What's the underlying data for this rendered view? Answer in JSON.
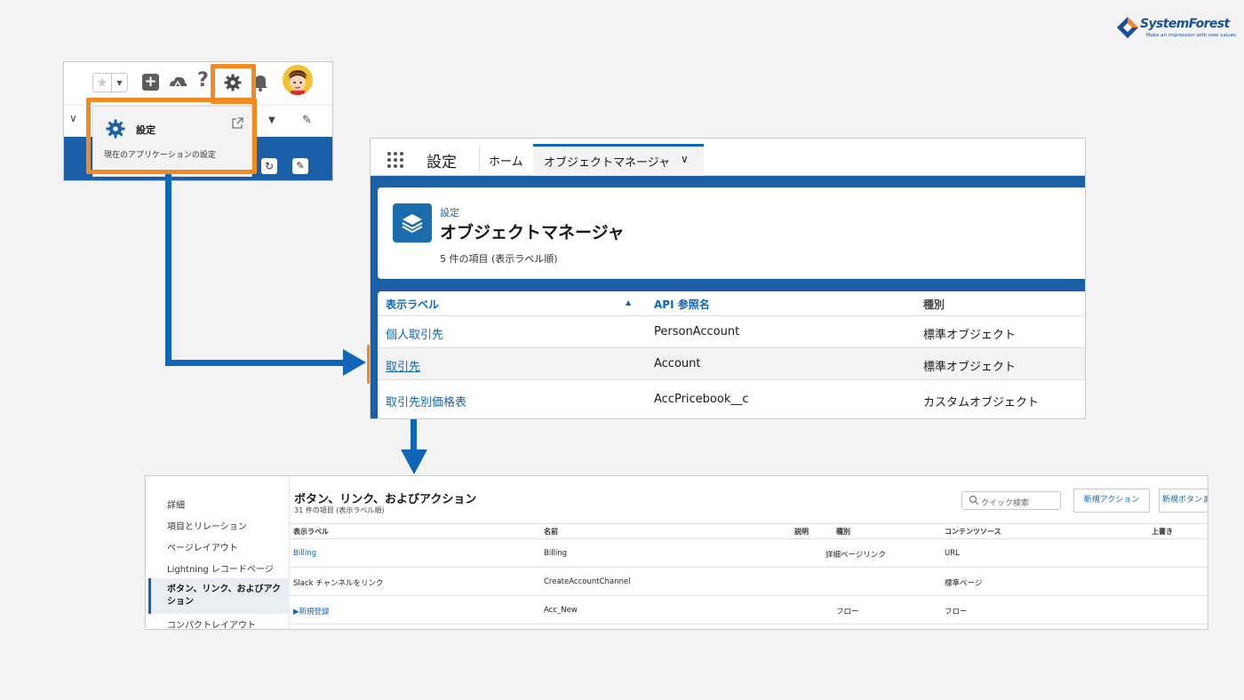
{
  "logo": {
    "name": "SystemForest",
    "tagline": "Make an impression with new values"
  },
  "panel1": {
    "settings_menu": {
      "title": "設定",
      "subtitle": "現在のアプリケーションの設定"
    }
  },
  "panel2": {
    "app_title": "設定",
    "tabs": [
      {
        "label": "ホーム"
      },
      {
        "label": "オブジェクトマネージャ"
      }
    ],
    "header": {
      "breadcrumb": "設定",
      "title": "オブジェクトマネージャ",
      "count": "5 件の項目 (表示ラベル順)"
    },
    "columns": [
      "表示ラベル",
      "API 参照名",
      "種別"
    ],
    "rows": [
      {
        "label": "個人取引先",
        "api": "PersonAccount",
        "kind": "標準オブジェクト"
      },
      {
        "label": "取引先",
        "api": "Account",
        "kind": "標準オブジェクト"
      },
      {
        "label": "取引先別価格表",
        "api": "AccPricebook__c",
        "kind": "カスタムオブジェクト"
      }
    ]
  },
  "panel3": {
    "sidebar": [
      "詳細",
      "項目とリレーション",
      "ページレイアウト",
      "Lightning レコードページ",
      "ボタン、リンク、およびアクション",
      "コンパクトレイアウト"
    ],
    "title": "ボタン、リンク、およびアクション",
    "count": "31 件の項目 (表示ラベル順)",
    "search_placeholder": "クイック検索",
    "new_action": "新規アクション",
    "new_button": "新規ボタンまたはリンク",
    "columns": [
      "表示ラベル",
      "名前",
      "説明",
      "種別",
      "コンテンツソース",
      "上書き"
    ],
    "rows": [
      {
        "label": "Billing",
        "name": "Billing",
        "desc": "",
        "kind": "詳細ページリンク",
        "source": "URL"
      },
      {
        "label": "Slack チャンネルをリンク",
        "name": "CreateAccountChannel",
        "desc": "",
        "kind": "",
        "source": "標準ページ"
      },
      {
        "label": "▶新規登録",
        "name": "Acc_New",
        "desc": "",
        "kind": "フロー",
        "source": "フロー"
      }
    ]
  },
  "colors": {
    "highlight": "#f28a22",
    "arrow": "#0f66b9",
    "salesforce_blue": "#1b5fa8"
  }
}
